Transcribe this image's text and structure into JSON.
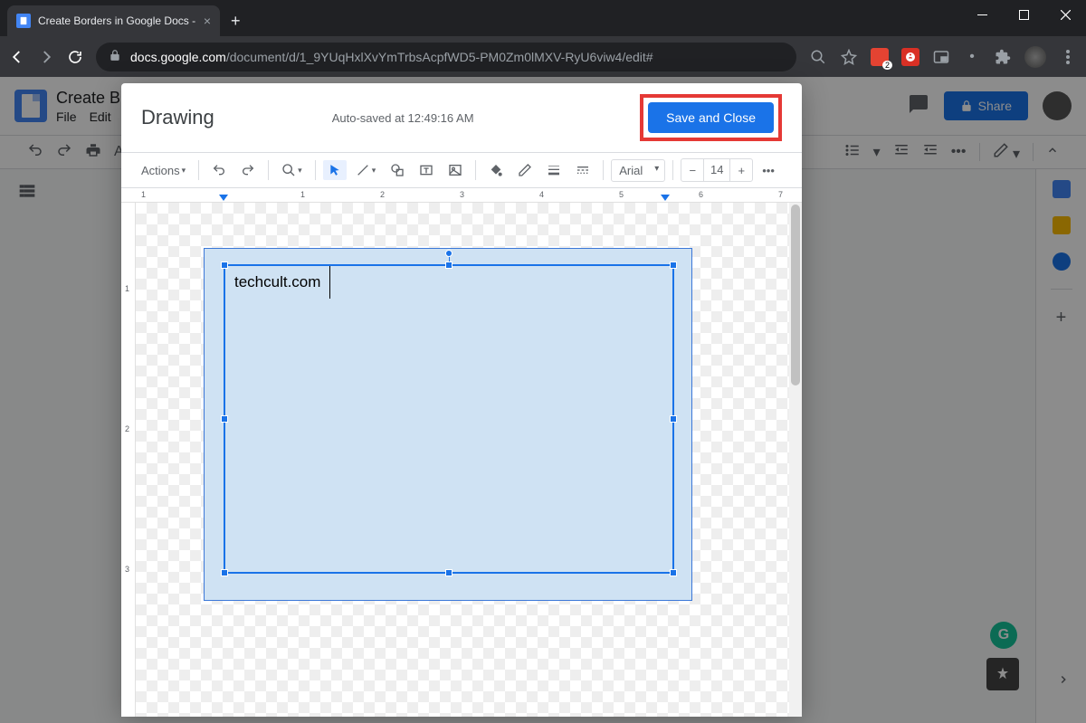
{
  "browser": {
    "tab_title": "Create Borders in Google Docs -",
    "url_host": "docs.google.com",
    "url_path": "/document/d/1_9YUqHxlXvYmTrbsAcpfWD5-PM0Zm0lMXV-RyU6viw4/edit#",
    "ext_badge": "2"
  },
  "docs": {
    "title": "Create B",
    "menus": [
      "File",
      "Edit"
    ],
    "share_label": "Share"
  },
  "drawing": {
    "title": "Drawing",
    "autosave": "Auto-saved at 12:49:16 AM",
    "save_close": "Save and Close",
    "actions_label": "Actions",
    "font_name": "Arial",
    "font_size": "14",
    "textbox_content": "techcult.com",
    "ruler_h": [
      "1",
      "1",
      "2",
      "3",
      "4",
      "5",
      "6",
      "7"
    ],
    "ruler_v": [
      "1",
      "2",
      "3"
    ]
  }
}
